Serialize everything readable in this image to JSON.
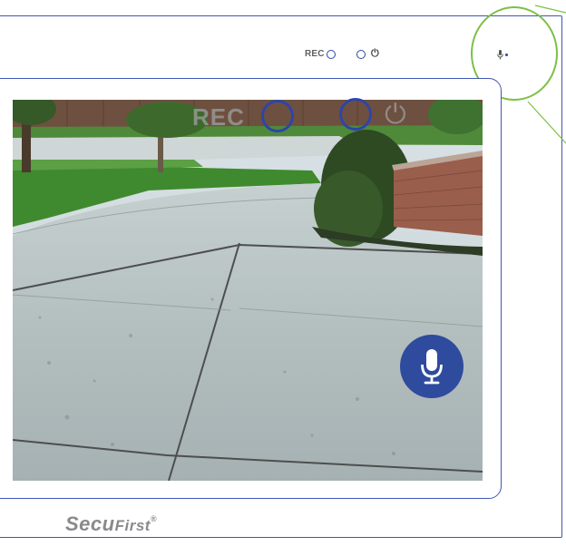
{
  "toolbar": {
    "rec_label": "REC",
    "power_glyph": "⏻",
    "rec_ring_icon": "circle-outline",
    "mic_icon": "microphone"
  },
  "video_overlay": {
    "rec_label": "REC",
    "power_glyph": "⏻"
  },
  "mic_button": {
    "icon": "microphone"
  },
  "brand": {
    "name_part1": "Secu",
    "name_part2": "First",
    "registered": "®"
  },
  "colors": {
    "frame": "#3f57b4",
    "accent": "#2f4b9e",
    "callout": "#7cc045"
  }
}
